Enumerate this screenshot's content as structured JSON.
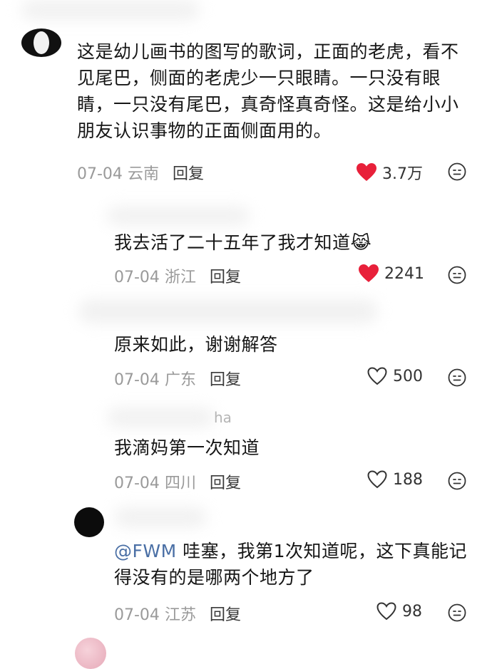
{
  "comments": [
    {
      "text": "这是幼儿画书的图写的歌词，正面的老虎，看不见尾巴，侧面的老虎少一只眼睛。一只没有眼睛，一只没有尾巴，真奇怪真奇怪。这是给小小朋友认识事物的正面侧面用的。",
      "date": "07-04",
      "location": "云南",
      "reply": "回复",
      "likes": "3.7万",
      "liked": true
    },
    {
      "text": "我去活了二十五年了我才知道",
      "emoji": "😹",
      "date": "07-04",
      "location": "浙江",
      "reply": "回复",
      "likes": "2241",
      "liked": true
    },
    {
      "text": "原来如此，谢谢解答",
      "date": "07-04",
      "location": "广东",
      "reply": "回复",
      "likes": "500",
      "liked": false
    },
    {
      "username_fragment": "ha",
      "text": "我滴妈第一次知道",
      "date": "07-04",
      "location": "四川",
      "reply": "回复",
      "likes": "188",
      "liked": false
    },
    {
      "mention": "@FWM",
      "text": " 哇塞，我第1次知道呢，这下真能记得没有的是哪两个地方了",
      "date": "07-04",
      "location": "江苏",
      "reply": "回复",
      "likes": "98",
      "liked": false
    }
  ],
  "colors": {
    "like_active": "#e8203a",
    "meta": "#9a9a9a",
    "mention": "#4a6fa5"
  },
  "icons": {
    "like": "heart-icon",
    "emoji": "smiley-icon"
  }
}
